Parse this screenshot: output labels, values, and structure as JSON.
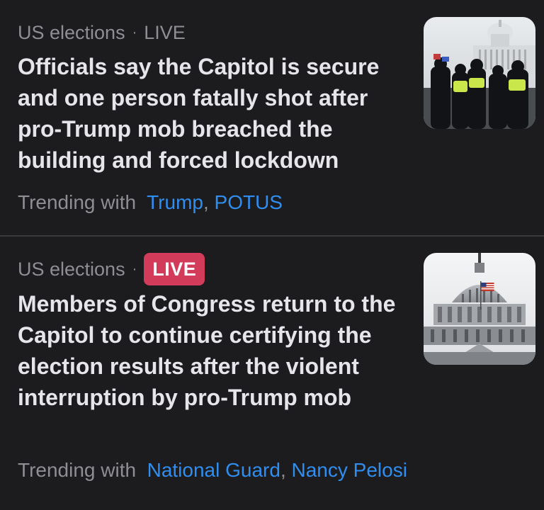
{
  "stories": [
    {
      "category": "US elections",
      "separator": "·",
      "live_label": "LIVE",
      "live_style": "plain",
      "headline": "Officials say the Capitol is secure and one person fatally shot after pro-Trump mob breached the building and forced lockdown",
      "trending_prefix": "Trending with",
      "trending_topics": [
        "Trump",
        "POTUS"
      ],
      "topic_separator": ",",
      "thumbnail_icon": "capitol-police-clash-photo"
    },
    {
      "category": "US elections",
      "separator": "·",
      "live_label": "LIVE",
      "live_style": "badge",
      "headline": "Members of Congress return to the Capitol to continue certifying the election results after the violent interruption by pro-Trump mob",
      "trending_prefix": "Trending with",
      "trending_topics": [
        "National Guard",
        "Nancy Pelosi"
      ],
      "topic_separator": ",",
      "thumbnail_icon": "capitol-dome-photo"
    }
  ],
  "colors": {
    "background": "#1c1c1e",
    "headline": "#e5e5ea",
    "meta": "#8e8e93",
    "link": "#2f8ef0",
    "live_badge": "#d23c5a",
    "divider": "#3a3a3c"
  }
}
